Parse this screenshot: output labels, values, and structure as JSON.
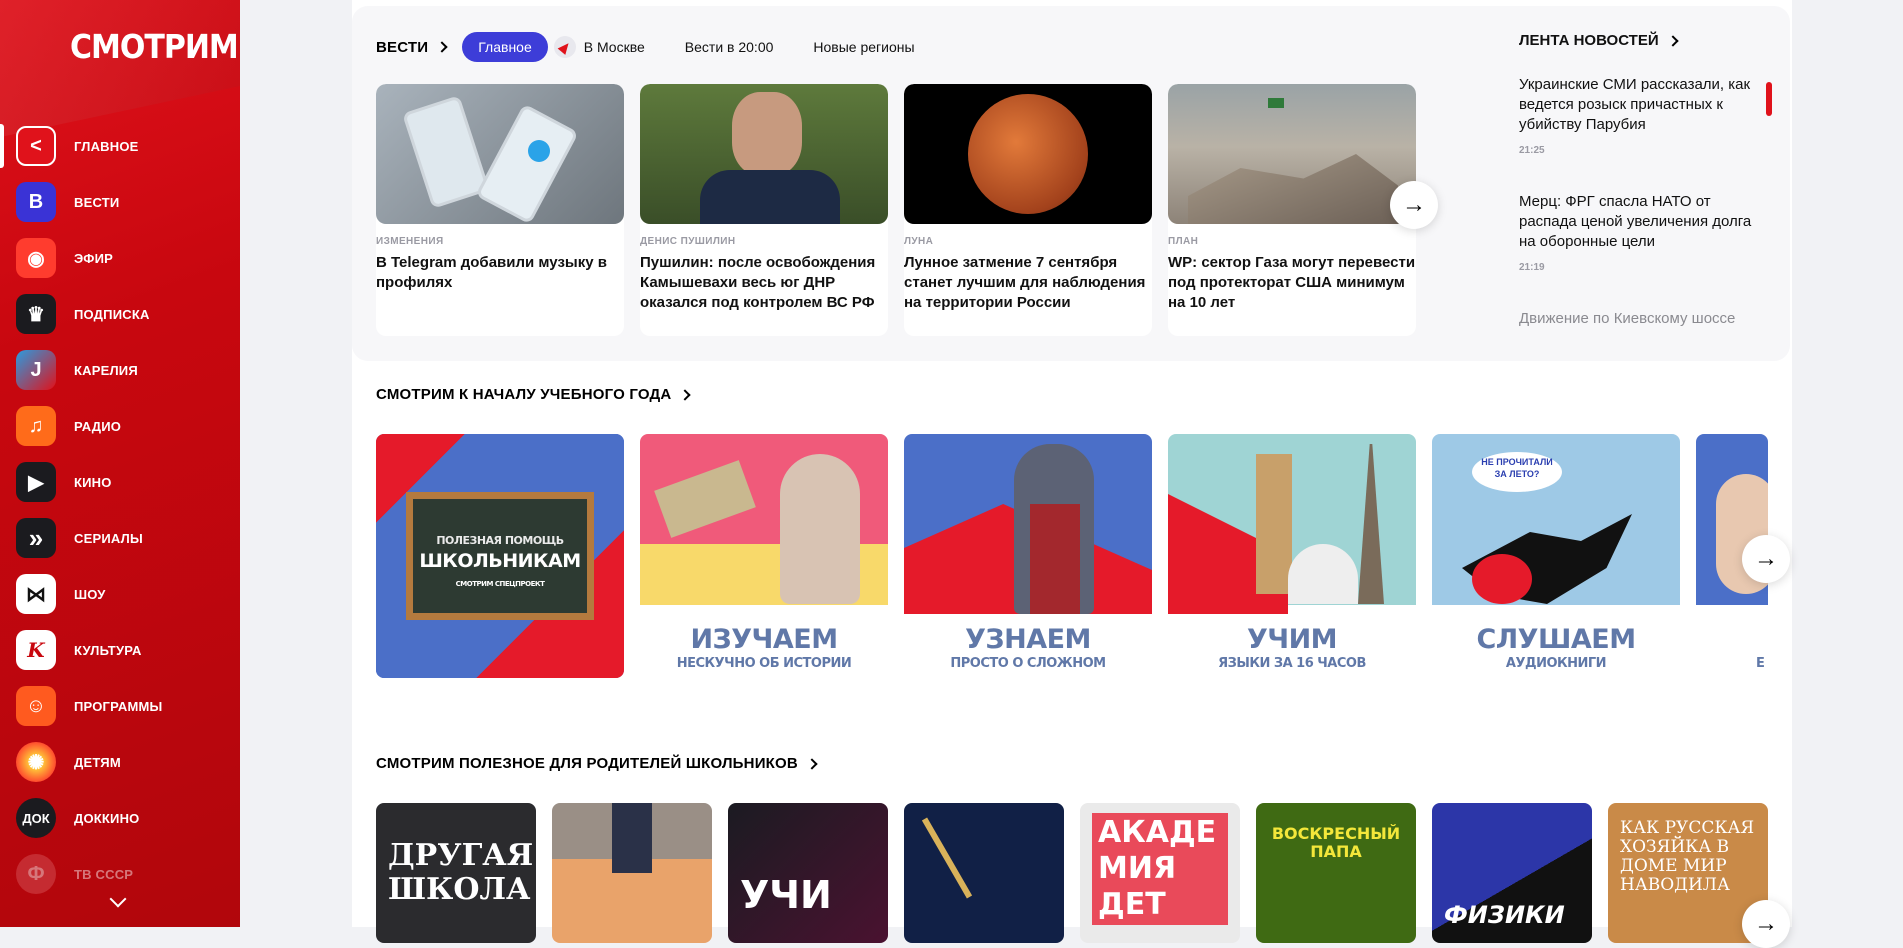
{
  "brand": {
    "logo": "СМОТРИМ",
    "accent": "#e0121b"
  },
  "sidebar": {
    "items": [
      {
        "label": "ГЛАВНОЕ",
        "icon": "home-chevron-icon",
        "color": "#e0121b",
        "active": true
      },
      {
        "label": "ВЕСТИ",
        "icon": "vesti-icon",
        "color": "#3a33d6"
      },
      {
        "label": "ЭФИР",
        "icon": "broadcast-icon",
        "color": "#ff3c2e"
      },
      {
        "label": "ПОДПИСКА",
        "icon": "crown-icon",
        "color": "#1b1b1f"
      },
      {
        "label": "КАРЕЛИЯ",
        "icon": "region-icon",
        "color": "#2b9be0"
      },
      {
        "label": "РАДИО",
        "icon": "music-note-icon",
        "color": "#ff6b1a"
      },
      {
        "label": "КИНО",
        "icon": "play-icon",
        "color": "#1b1b1f"
      },
      {
        "label": "СЕРИАЛЫ",
        "icon": "chevrons-icon",
        "color": "#1b1b1f"
      },
      {
        "label": "ШОУ",
        "icon": "bowtie-icon",
        "color": "#ffffff"
      },
      {
        "label": "КУЛЬТУРА",
        "icon": "culture-k-icon",
        "color": "#ffffff"
      },
      {
        "label": "ПРОГРАММЫ",
        "icon": "smile-icon",
        "color": "#ff5a1f"
      },
      {
        "label": "ДЕТЯМ",
        "icon": "kids-icon",
        "color": "#ff4d2e"
      },
      {
        "label": "ДОККИНО",
        "icon": "dokkino-icon",
        "color": "#1b1b1f"
      },
      {
        "label": "ТВ СССР",
        "icon": "ussr-icon",
        "color": "#a33"
      }
    ],
    "glyphs": [
      "<",
      "В",
      "◉",
      "♛",
      "J",
      "♫",
      "▶",
      "»",
      "⋈",
      "K",
      "☺",
      "✺",
      "ДОК",
      "Ф"
    ]
  },
  "news": {
    "title": "ВЕСТИ",
    "tabs": [
      "Главное",
      "В Москве",
      "Вести в 20:00",
      "Новые регионы"
    ],
    "cards": [
      {
        "tag": "ИЗМЕНЕНИЯ",
        "title": "В Telegram добавили музыку в профилях"
      },
      {
        "tag": "ДЕНИС ПУШИЛИН",
        "title": "Пушилин: после освобождения Камышевахи весь юг ДНР оказался под контролем ВС РФ"
      },
      {
        "tag": "ЛУНА",
        "title": "Лунное затмение 7 сентября станет лучшим для наблюдения на территории России"
      },
      {
        "tag": "ПЛАН",
        "title": "WP: сектор Газа могут перевести под протекторат США минимум на 10 лет"
      }
    ]
  },
  "feed": {
    "title": "ЛЕНТА НОВОСТЕЙ",
    "items": [
      {
        "text": "Украинские СМИ рассказали, как ведется розыск причастных к убийству Парубия",
        "time": "21:25"
      },
      {
        "text": "Мерц: ФРГ спасла НАТО от распада ценой увеличения долга на оборонные цели",
        "time": "21:19"
      },
      {
        "text": "Движение по Киевскому шоссе"
      }
    ]
  },
  "school": {
    "title": "СМОТРИМ К НАЧАЛУ УЧЕБНОГО ГОДА",
    "covers": [
      {
        "big": "ПОЛЕЗНАЯ ПОМОЩЬ",
        "big2": "ШКОЛЬНИКАМ",
        "sub": "СМОТРИМ СПЕЦПРОЕКТ"
      },
      {
        "big": "ИЗУЧАЕМ",
        "sub": "НЕСКУЧНО ОБ ИСТОРИИ"
      },
      {
        "big": "УЗНАЕМ",
        "sub": "ПРОСТО О СЛОЖНОМ"
      },
      {
        "big": "УЧИМ",
        "sub": "ЯЗЫКИ ЗА 16 ЧАСОВ"
      },
      {
        "big": "СЛУШАЕМ",
        "sub": "АУДИОКНИГИ",
        "bubble": "НЕ ПРОЧИТАЛИ ЗА ЛЕТО?"
      },
      {
        "big": "",
        "sub": "Е"
      }
    ]
  },
  "parents": {
    "title": "СМОТРИМ ПОЛЕЗНОЕ ДЛЯ РОДИТЕЛЕЙ ШКОЛЬНИКОВ",
    "tiles": [
      {
        "text": "ДРУГАЯ ШКОЛА"
      },
      {
        "text": ""
      },
      {
        "text": "УЧИ"
      },
      {
        "text": ""
      },
      {
        "text": "АКАДЕ МИЯ ДЕТ"
      },
      {
        "text": "ВОСКРЕСНЫЙ ПАПА"
      },
      {
        "text": "ФИЗИКИ"
      },
      {
        "text": "КАК РУССКАЯ ХОЗЯЙКА В ДОМЕ МИР НАВОДИЛА"
      }
    ]
  }
}
